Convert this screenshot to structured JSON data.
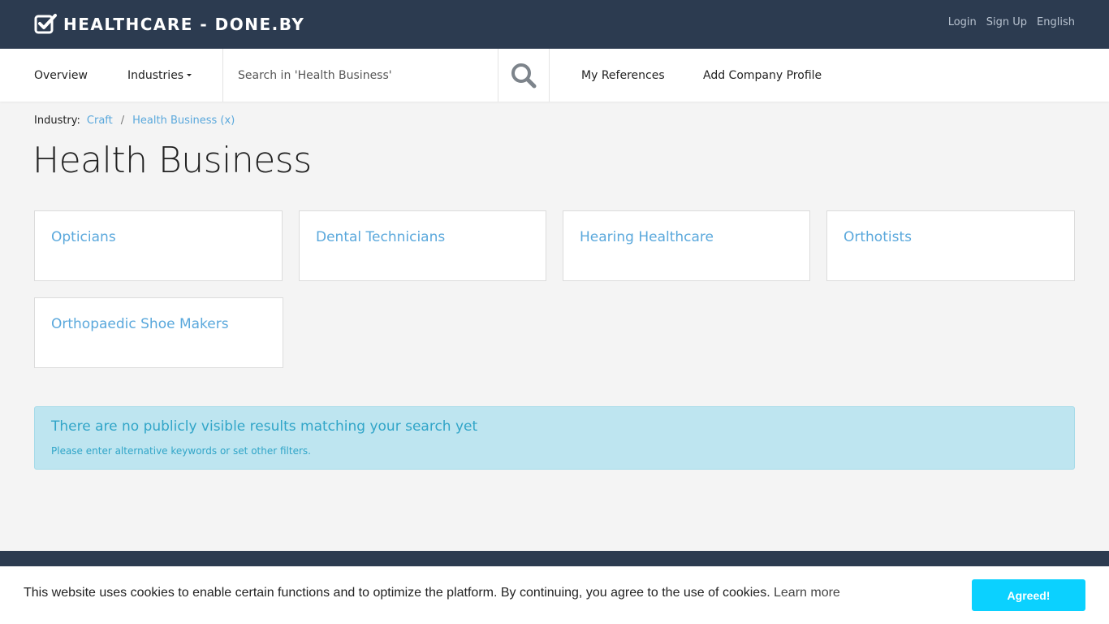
{
  "brand": {
    "name": "HEALTHCARE - DONE.BY",
    "icon": "checkbox-check-icon"
  },
  "top_links": {
    "login": "Login",
    "signup": "Sign Up",
    "language": "English"
  },
  "nav": {
    "overview": "Overview",
    "industries": "Industries",
    "search_placeholder": "Search in 'Health Business'",
    "my_references": "My References",
    "add_company_profile": "Add Company Profile"
  },
  "breadcrumb": {
    "label": "Industry:",
    "items": [
      "Craft",
      "Health Business (x)"
    ],
    "separator": "/"
  },
  "page_title": "Health Business",
  "categories": [
    "Opticians",
    "Dental Technicians",
    "Hearing Healthcare",
    "Orthotists",
    "Orthopaedic Shoe Makers"
  ],
  "alert": {
    "title": "There are no publicly visible results matching your search yet",
    "text": "Please enter alternative keywords or set other filters."
  },
  "cookie": {
    "text": "This website uses cookies to enable certain functions and to optimize the platform. By continuing, you agree to the use of cookies.",
    "learn_more": "Learn more",
    "accept": "Agreed!"
  },
  "colors": {
    "header_bg": "#2c3b50",
    "link": "#5aa8dc",
    "alert_bg": "#bee5f0",
    "accept_button": "#0bd1ff"
  }
}
